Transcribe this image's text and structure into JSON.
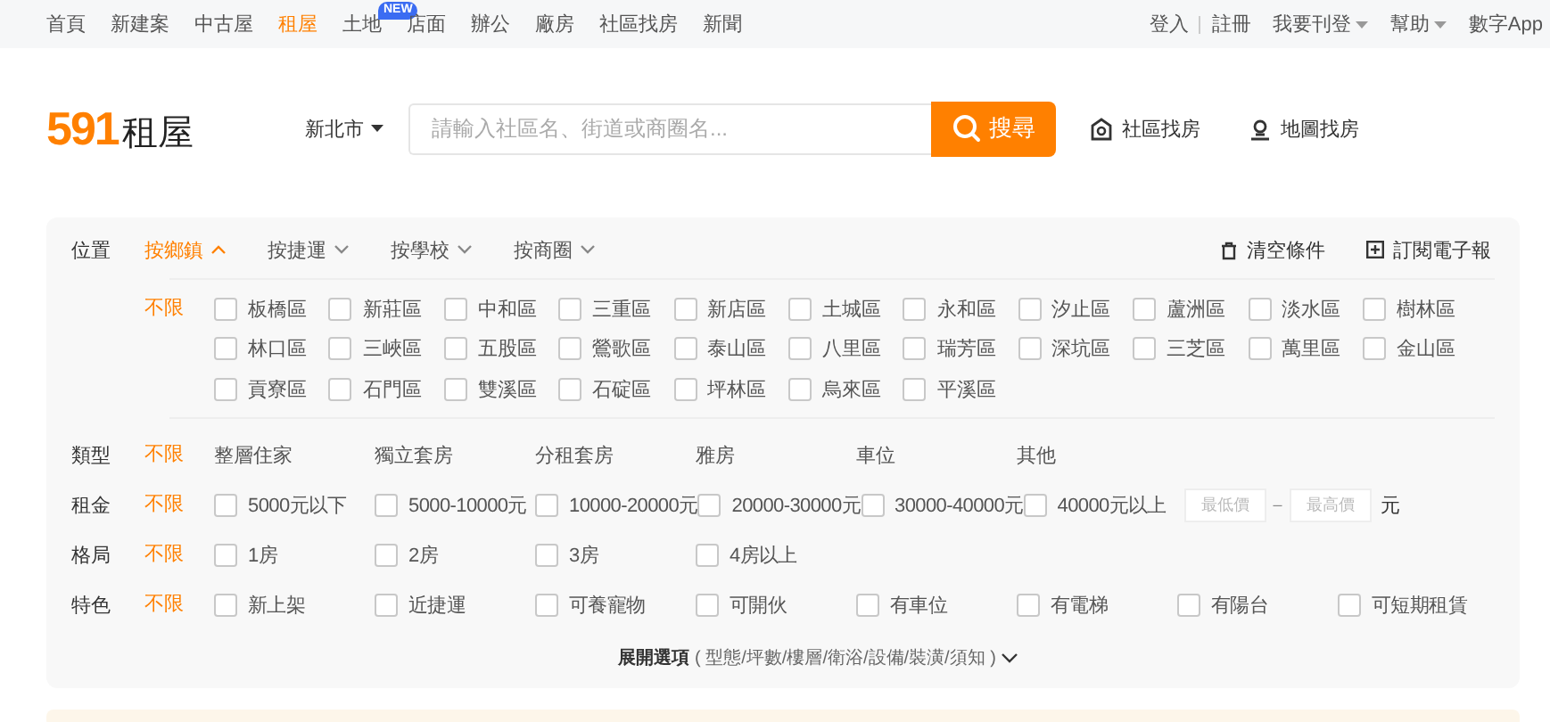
{
  "top_nav": {
    "items": [
      {
        "label": "首頁",
        "selected": false
      },
      {
        "label": "新建案",
        "selected": false
      },
      {
        "label": "中古屋",
        "selected": false
      },
      {
        "label": "租屋",
        "selected": true
      },
      {
        "label": "土地",
        "selected": false,
        "badge": "NEW"
      },
      {
        "label": "店面",
        "selected": false
      },
      {
        "label": "辦公",
        "selected": false
      },
      {
        "label": "廠房",
        "selected": false
      },
      {
        "label": "社區找房",
        "selected": false
      },
      {
        "label": "新聞",
        "selected": false
      }
    ],
    "right": [
      {
        "label": "登入",
        "kind": "link"
      },
      {
        "label": "註冊",
        "kind": "link"
      },
      {
        "label": "我要刊登",
        "kind": "dropdown"
      },
      {
        "label": "幫助",
        "kind": "dropdown"
      },
      {
        "label": "數字App",
        "kind": "link"
      }
    ]
  },
  "header": {
    "logo_number": "591",
    "logo_text": "租屋",
    "city": "新北市",
    "search": {
      "placeholder": "請輸入社區名、街道或商圈名...",
      "button": "搜尋"
    },
    "links": [
      {
        "label": "社區找房",
        "kind": "community"
      },
      {
        "label": "地圖找房",
        "kind": "map"
      }
    ]
  },
  "filters": {
    "location": {
      "label": "位置",
      "tabs": [
        {
          "label": "按鄉鎮",
          "selected": true
        },
        {
          "label": "按捷運",
          "selected": false
        },
        {
          "label": "按學校",
          "selected": false
        },
        {
          "label": "按商圈",
          "selected": false
        }
      ],
      "actions": [
        {
          "label": "清空條件",
          "kind": "clear"
        },
        {
          "label": "訂閱電子報",
          "kind": "subscribe"
        }
      ],
      "any": {
        "label": "不限",
        "selected": true
      },
      "districts": [
        {
          "label": "板橋區",
          "checked": false
        },
        {
          "label": "新莊區",
          "checked": false
        },
        {
          "label": "中和區",
          "checked": false
        },
        {
          "label": "三重區",
          "checked": false
        },
        {
          "label": "新店區",
          "checked": false
        },
        {
          "label": "土城區",
          "checked": false
        },
        {
          "label": "永和區",
          "checked": false
        },
        {
          "label": "汐止區",
          "checked": false
        },
        {
          "label": "蘆洲區",
          "checked": false
        },
        {
          "label": "淡水區",
          "checked": false
        },
        {
          "label": "樹林區",
          "checked": false
        },
        {
          "label": "林口區",
          "checked": false
        },
        {
          "label": "三峽區",
          "checked": false
        },
        {
          "label": "五股區",
          "checked": false
        },
        {
          "label": "鶯歌區",
          "checked": false
        },
        {
          "label": "泰山區",
          "checked": false
        },
        {
          "label": "八里區",
          "checked": false
        },
        {
          "label": "瑞芳區",
          "checked": false
        },
        {
          "label": "深坑區",
          "checked": false
        },
        {
          "label": "三芝區",
          "checked": false
        },
        {
          "label": "萬里區",
          "checked": false
        },
        {
          "label": "金山區",
          "checked": false
        },
        {
          "label": "貢寮區",
          "checked": false
        },
        {
          "label": "石門區",
          "checked": false
        },
        {
          "label": "雙溪區",
          "checked": false
        },
        {
          "label": "石碇區",
          "checked": false
        },
        {
          "label": "坪林區",
          "checked": false
        },
        {
          "label": "烏來區",
          "checked": false
        },
        {
          "label": "平溪區",
          "checked": false
        }
      ]
    },
    "rows": [
      {
        "label": "類型",
        "any": {
          "label": "不限",
          "selected": true
        },
        "kind": "plain",
        "options": [
          {
            "label": "整層住家"
          },
          {
            "label": "獨立套房"
          },
          {
            "label": "分租套房"
          },
          {
            "label": "雅房"
          },
          {
            "label": "車位"
          },
          {
            "label": "其他"
          }
        ]
      },
      {
        "label": "租金",
        "any": {
          "label": "不限",
          "selected": true
        },
        "kind": "checkbox",
        "options": [
          {
            "label": "5000元以下",
            "checked": false
          },
          {
            "label": "5000-10000元",
            "checked": false
          },
          {
            "label": "10000-20000元",
            "checked": false
          },
          {
            "label": "20000-30000元",
            "checked": false
          },
          {
            "label": "30000-40000元",
            "checked": false
          },
          {
            "label": "40000元以上",
            "checked": false
          }
        ],
        "price_range": {
          "min_placeholder": "最低價",
          "separator": "–",
          "max_placeholder": "最高價",
          "unit": "元"
        }
      },
      {
        "label": "格局",
        "any": {
          "label": "不限",
          "selected": true
        },
        "kind": "checkbox",
        "options": [
          {
            "label": "1房",
            "checked": false
          },
          {
            "label": "2房",
            "checked": false
          },
          {
            "label": "3房",
            "checked": false
          },
          {
            "label": "4房以上",
            "checked": false
          }
        ]
      },
      {
        "label": "特色",
        "any": {
          "label": "不限",
          "selected": true
        },
        "kind": "checkbox",
        "options": [
          {
            "label": "新上架",
            "checked": false
          },
          {
            "label": "近捷運",
            "checked": false
          },
          {
            "label": "可養寵物",
            "checked": false
          },
          {
            "label": "可開伙",
            "checked": false
          },
          {
            "label": "有車位",
            "checked": false
          },
          {
            "label": "有電梯",
            "checked": false
          },
          {
            "label": "有陽台",
            "checked": false
          },
          {
            "label": "可短期租賃",
            "checked": false
          }
        ]
      }
    ],
    "expand": {
      "label": "展開選項",
      "detail": "( 型態/坪數/樓層/衛浴/設備/裝潢/須知 )",
      "expanded": false
    }
  }
}
